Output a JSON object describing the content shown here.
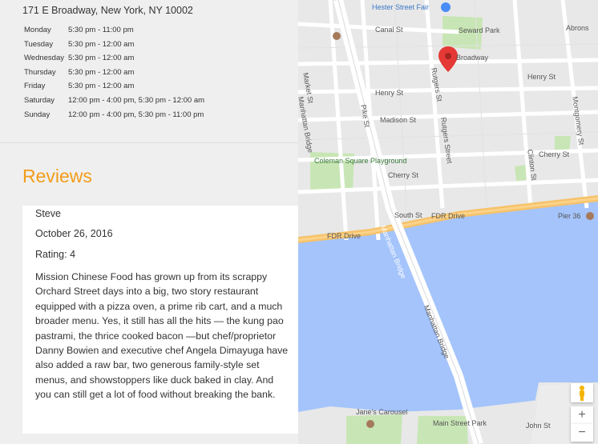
{
  "address": "171 E Broadway, New York, NY 10002",
  "hours": [
    {
      "day": "Monday",
      "time": "5:30 pm - 11:00 pm"
    },
    {
      "day": "Tuesday",
      "time": "5:30 pm - 12:00 am"
    },
    {
      "day": "Wednesday",
      "time": "5:30 pm - 12:00 am"
    },
    {
      "day": "Thursday",
      "time": "5:30 pm - 12:00 am"
    },
    {
      "day": "Friday",
      "time": "5:30 pm - 12:00 am"
    },
    {
      "day": "Saturday",
      "time": "12:00 pm - 4:00 pm, 5:30 pm - 12:00 am"
    },
    {
      "day": "Sunday",
      "time": "12:00 pm - 4:00 pm, 5:30 pm - 11:00 pm"
    }
  ],
  "reviews": {
    "title": "Reviews",
    "items": [
      {
        "author": "Steve",
        "date": "October 26, 2016",
        "rating": "Rating: 4",
        "text": "Mission Chinese Food has grown up from its scrappy Orchard Street days into a big, two story restaurant equipped with a pizza oven, a prime rib cart, and a much broader menu. Yes, it still has all the hits — the kung pao pastrami, the thrice cooked bacon —but chef/proprietor Danny Bowien and executive chef Angela Dimayuga have also added a raw bar, two generous family-style set menus, and showstoppers like duck baked in clay. And you can still get a lot of food without breaking the bank."
      }
    ]
  },
  "map": {
    "labels": {
      "hester_street_fair": "Hester Street Fair",
      "canal_st": "Canal St",
      "seward_park": "Seward Park",
      "abrons": "Abrons",
      "broadway": "Broadway",
      "henry_st_top": "Henry St",
      "henry_st_left": "Henry St",
      "madison_st": "Madison St",
      "coleman_playground": "Coleman Square Playground",
      "cherry_st_left": "Cherry St",
      "cherry_st_right": "Cherry St",
      "south_st": "South St",
      "fdr_drive": "FDR Drive",
      "fdr_drive_left": "FDR Drive",
      "pier_36": "Pier 36",
      "manhattan_bridge": "Manhattan Bridge",
      "manhattan_bridge_river": "Manhattan Bridge",
      "manhattan_bridge_lower": "Manhattan Bridge",
      "market_st": "Market St",
      "pike_st": "Pike St",
      "rutgers_st": "Rutgers St",
      "rutgers_street": "Rutgers Street",
      "clinton_st": "Clinton St",
      "montgomery_st": "Montgomery St",
      "janes_carousel": "Jane's Carousel",
      "main_street_park": "Main Street Park",
      "john_st": "John St"
    },
    "zoom_in": "+",
    "zoom_out": "−"
  }
}
